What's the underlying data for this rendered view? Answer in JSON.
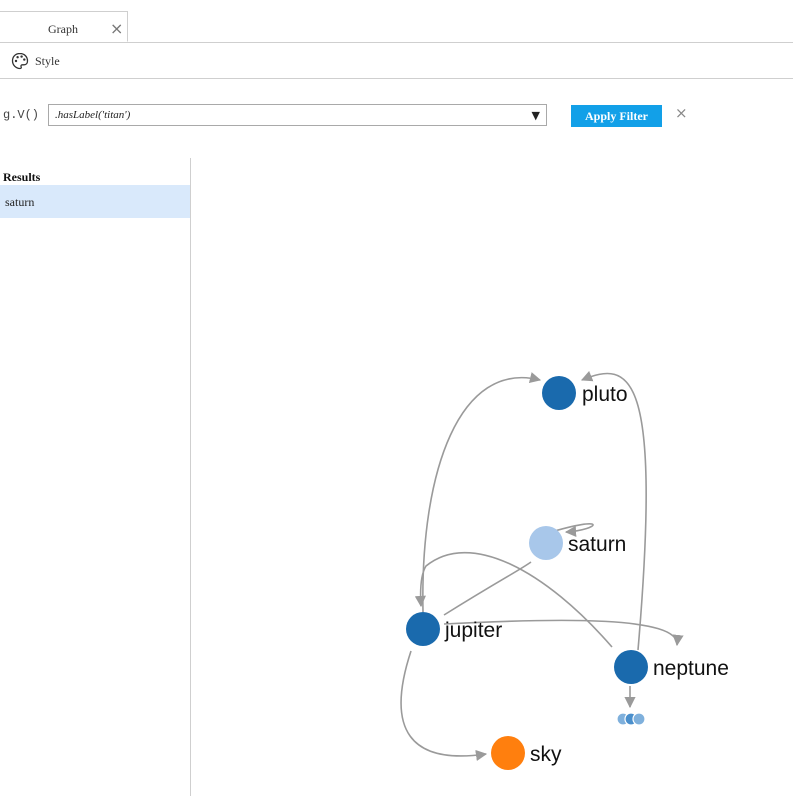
{
  "tabs": [
    {
      "label": "Graph",
      "close_icon": "close-icon"
    }
  ],
  "toolbar": {
    "style_label": "Style",
    "style_icon": "palette-icon"
  },
  "query": {
    "prefix": "g.V()",
    "filter_value": ".hasLabel('titan')",
    "apply_label": "Apply Filter",
    "clear_icon": "close-icon"
  },
  "results": {
    "header": "Results",
    "items": [
      "saturn"
    ]
  },
  "graph": {
    "colors": {
      "default": "#1a6aad",
      "selected": "#a8c7ea",
      "sky": "#ff7f0e",
      "edge": "#9a9a9a",
      "accent": "#12a0e8"
    },
    "nodes": [
      {
        "label": "pluto"
      },
      {
        "label": "saturn"
      },
      {
        "label": "jupiter"
      },
      {
        "label": "neptune"
      },
      {
        "label": "sky"
      }
    ]
  }
}
